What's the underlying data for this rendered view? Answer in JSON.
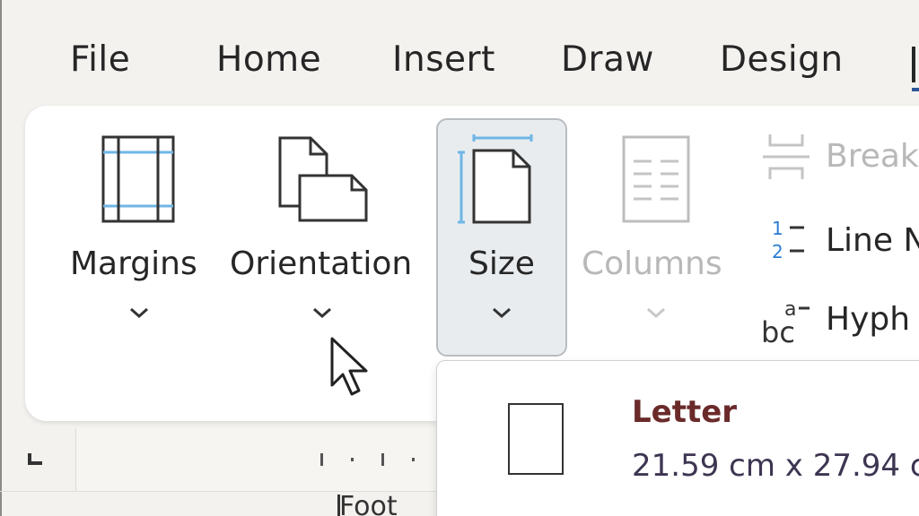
{
  "tabs": [
    "File",
    "Home",
    "Insert",
    "Draw",
    "Design"
  ],
  "ribbon": {
    "margins": "Margins",
    "orientation": "Orientation",
    "size": "Size",
    "columns": "Columns",
    "breaks": "Breaks",
    "line_numbers": "Line N",
    "hyphenation": "Hyph",
    "hyphenation_icon": "bc"
  },
  "size_dropdown": {
    "item_title": "Letter",
    "item_dims": "21.59 cm x 27.94 c"
  },
  "footer": {
    "text": "Foot"
  },
  "colors": {
    "accent": "#2b5797",
    "icon_blue": "#6fb6e6",
    "letter_title": "#6b2a2a"
  },
  "icons": {
    "margins": "margins-icon",
    "orientation": "orientation-icon",
    "size": "size-icon",
    "columns": "columns-icon",
    "breaks": "breaks-icon",
    "line_numbers": "line-numbers-icon",
    "hyphenation": "hyphenation-icon",
    "cursor": "mouse-pointer-icon"
  }
}
